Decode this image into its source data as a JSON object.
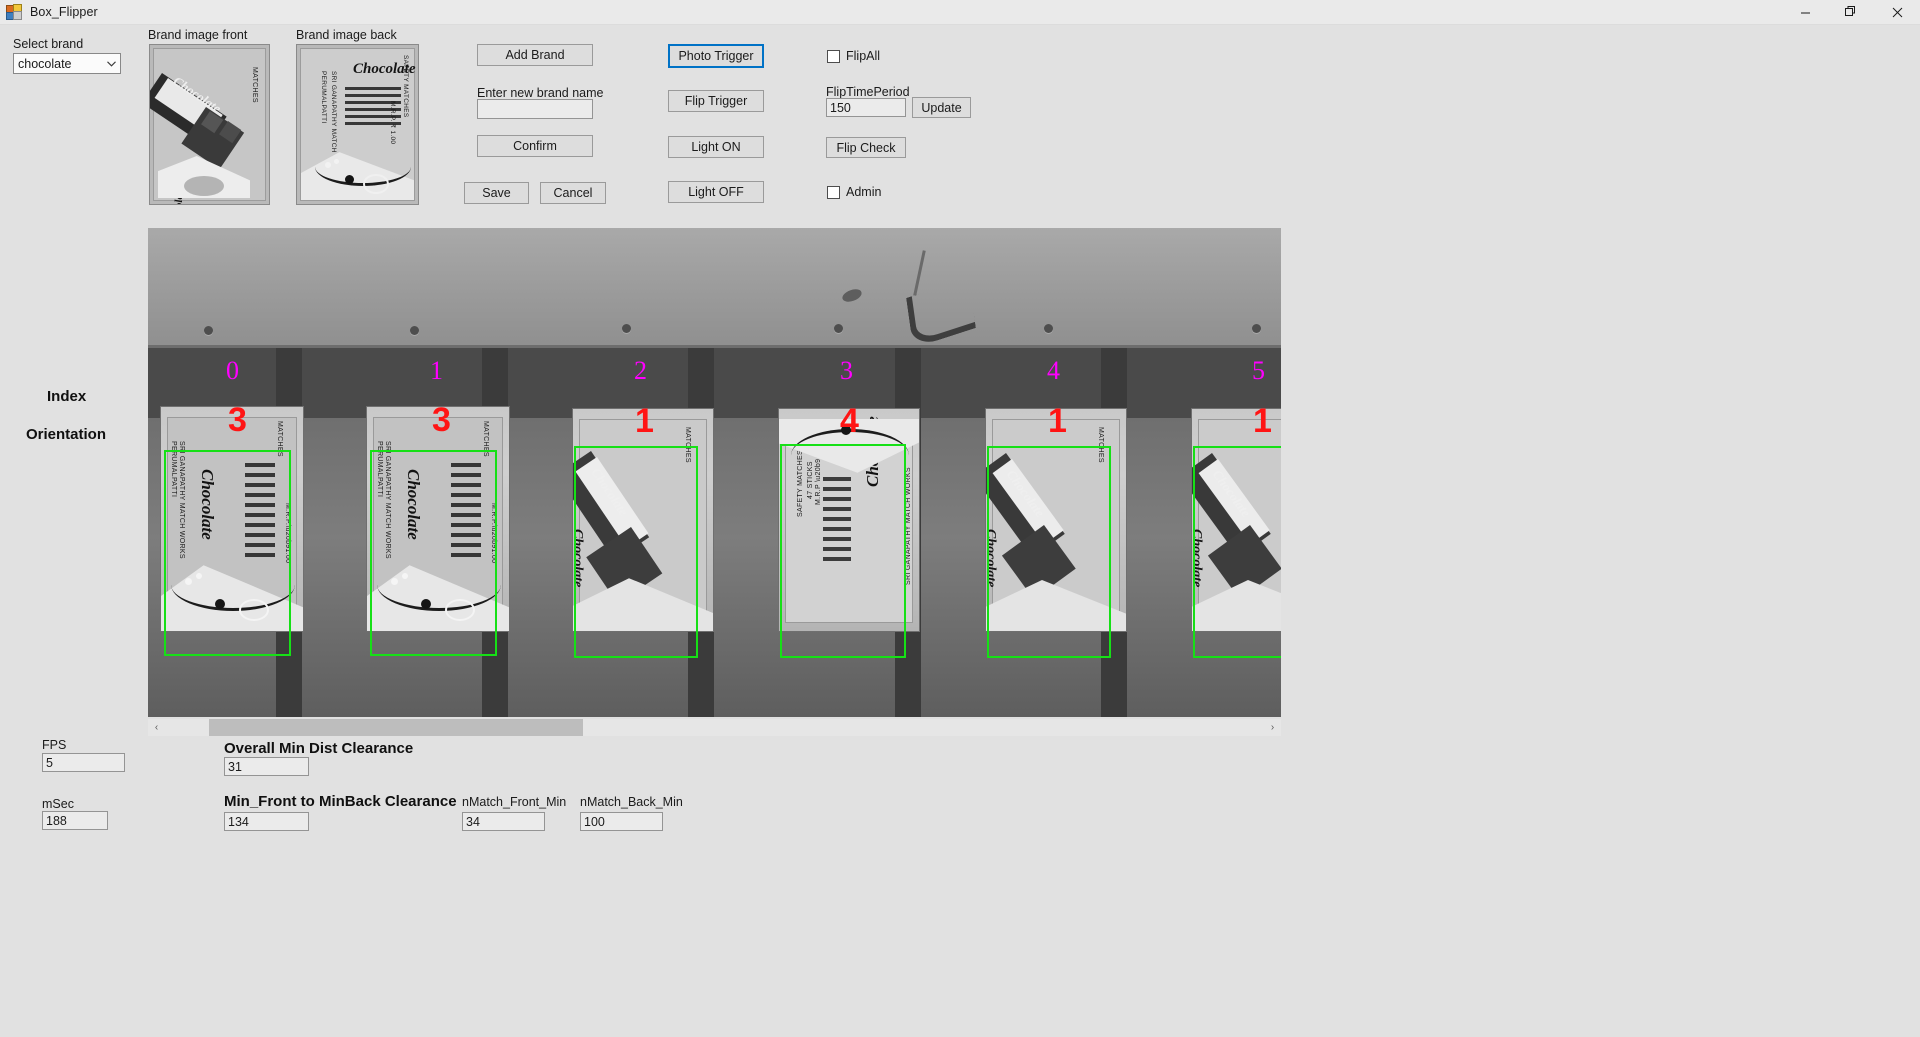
{
  "window": {
    "title": "Box_Flipper",
    "icon": "app-icon",
    "minimize": "—",
    "maximize": "❐",
    "close": "✕"
  },
  "brand": {
    "select_label": "Select brand",
    "selected": "chocolate",
    "options": [
      "chocolate"
    ],
    "front_label": "Brand image front",
    "back_label": "Brand image back",
    "front_image_texts": {
      "brand": "Chocolate",
      "side_right": "MATCHES",
      "side_left": "Chocolate"
    },
    "back_image_texts": {
      "brand": "Chocolate",
      "maker": "SRI GANAPATHY MATCH WORKS",
      "place": "PERUMALPATTI",
      "side_top": "SAFETY MATCHES",
      "side_right": "M.R.P. ₹ 1.00"
    }
  },
  "form": {
    "add_brand": "Add Brand",
    "new_brand_label": "Enter new brand name",
    "new_brand_value": "",
    "new_brand_placeholder": "",
    "confirm": "Confirm",
    "save": "Save",
    "cancel": "Cancel"
  },
  "triggers": {
    "photo_trigger": "Photo Trigger",
    "flip_trigger": "Flip Trigger",
    "light_on": "Light ON",
    "light_off": "Light OFF",
    "focused_button": "Photo Trigger",
    "focus_color": "#0072c6"
  },
  "options": {
    "flip_all_label": "FlipAll",
    "flip_all_checked": false,
    "flip_time_period_label": "FlipTimePeriod",
    "flip_time_period_value": "150",
    "update": "Update",
    "flip_check": "Flip Check",
    "admin_label": "Admin",
    "admin_checked": false
  },
  "viewer": {
    "index_label": "Index",
    "orientation_label": "Orientation",
    "index_color": "#ff00ff",
    "orientation_color": "#ff1414",
    "detection_box_color": "#16e016",
    "indices": [
      "0",
      "1",
      "2",
      "3",
      "4",
      "5"
    ],
    "orientations": [
      "3",
      "3",
      "1",
      "4",
      "1",
      "1"
    ],
    "scroll": {
      "left_arrow": "‹",
      "right_arrow": "›",
      "thumb_start_pct": 4,
      "thumb_width_pct": 34
    }
  },
  "metrics": {
    "fps_label": "FPS",
    "fps_value": "5",
    "msec_label": "mSec",
    "msec_value": "188",
    "overall_min_dist_label": "Overall Min Dist Clearance",
    "overall_min_dist_value": "31",
    "min_front_back_label": "Min_Front to MinBack Clearance",
    "min_front_back_value": "134",
    "nmatch_front_label": "nMatch_Front_Min",
    "nmatch_front_value": "34",
    "nmatch_back_label": "nMatch_Back_Min",
    "nmatch_back_value": "100"
  }
}
